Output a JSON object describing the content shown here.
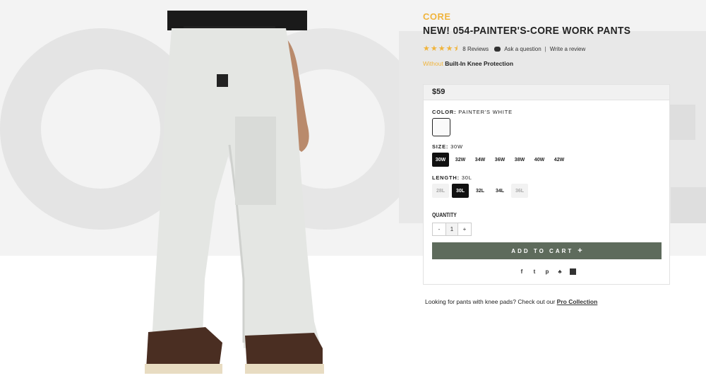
{
  "product": {
    "brand": "CORE",
    "title": "NEW! 054-PAINTER'S-CORE WORK PANTS",
    "rating_stars": 4.5,
    "reviews_label": "8 Reviews",
    "ask_label": "Ask a question",
    "separator": "|",
    "write_review_label": "Write a review",
    "tagline_highlight": "Without",
    "tagline_rest": "Built-In Knee Protection",
    "price": "$59"
  },
  "options": {
    "color_label": "COLOR:",
    "color_value": "PAINTER'S WHITE",
    "size_label": "SIZE:",
    "size_value": "30W",
    "sizes": [
      "30W",
      "32W",
      "34W",
      "36W",
      "38W",
      "40W",
      "42W"
    ],
    "length_label": "LENGTH:",
    "length_value": "30L",
    "lengths": [
      "28L",
      "30L",
      "32L",
      "34L",
      "36L"
    ]
  },
  "quantity": {
    "label": "QUANTITY",
    "minus": "-",
    "value": "1",
    "plus": "+"
  },
  "cart": {
    "label": "ADD TO CART",
    "icon": "+"
  },
  "share": [
    "f",
    "t",
    "p",
    "q",
    "mail"
  ],
  "note": {
    "text": "Looking for pants with knee pads? Check out our",
    "link": "Pro Collection"
  },
  "colors": {
    "accent": "#f0b43c",
    "cart_bg": "#5e6b5c"
  }
}
